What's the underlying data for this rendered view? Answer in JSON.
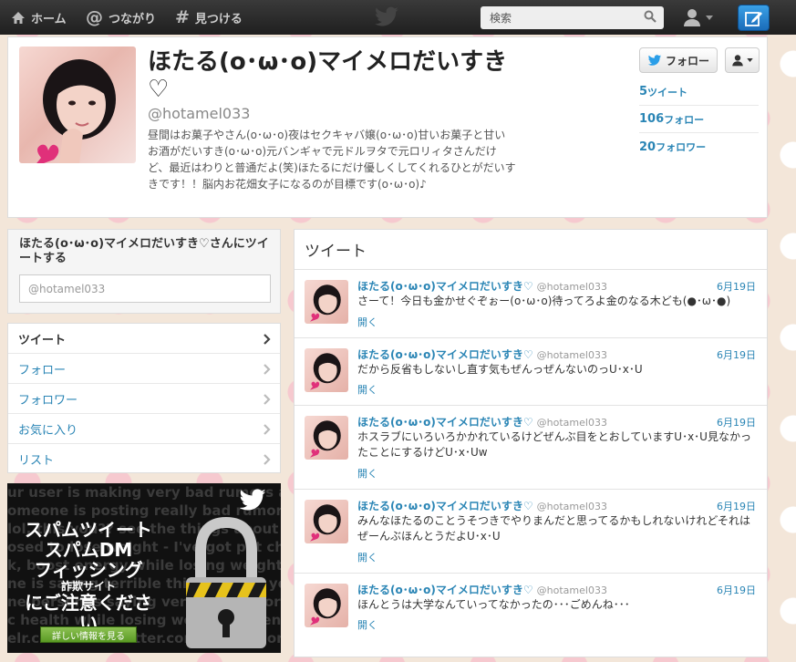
{
  "topbar": {
    "home_label": "ホーム",
    "connect_label": "つながり",
    "discover_label": "見つける",
    "search_placeholder": "検索"
  },
  "profile": {
    "name": "ほたる(o･ω･o)マイメロだいすき♡",
    "handle": "@hotamel033",
    "bio": "昼間はお菓子やさん(o･ω･o)夜はセクキャバ嬢(o･ω･o)甘いお菓子と甘いお酒がだいすき(o･ω･o)元バンギャで元ドルヲタで元ロリィタさんだけど、最近はわりと普通だよ(笑)ほたるにだけ優しくしてくれるひとがだいすきです！！脳内お花畑女子になるのが目標です(o･ω･o)♪",
    "follow_label": "フォロー",
    "stats": [
      {
        "num": "5",
        "label": "ツイート"
      },
      {
        "num": "106",
        "label": "フォロー"
      },
      {
        "num": "20",
        "label": "フォロワー"
      }
    ]
  },
  "tweetbox": {
    "title": "ほたる(o･ω･o)マイメロだいすき♡さんにツイートする",
    "value": "@hotamel033"
  },
  "leftnav": [
    {
      "label": "ツイート"
    },
    {
      "label": "フォロー"
    },
    {
      "label": "フォロワー"
    },
    {
      "label": "お気に入り"
    },
    {
      "label": "リスト"
    }
  ],
  "spam": {
    "bg_lines": [
      "ur user is making very bad rumors abou",
      "omeone is posting really bad rumors ab",
      "lol, this you?? see the things about you",
      "osed to lose weight - I've got pet changes",
      "k, boost energy while losing weight, health",
      "ne is saying terrible things about you...",
      "ne person is saying very bad rumors about",
      "c health while losing weight and energy",
      "elr.com  www.twitter.com  twitter.com"
    ],
    "line1": "スパムツイート",
    "line2": "スパムDM",
    "line3": "フィッシング",
    "line4": "詐欺サイト",
    "line5": "にご注意ください",
    "button": "詳しい情報を見る"
  },
  "timeline": {
    "header": "ツイート",
    "tweets": [
      {
        "name": "ほたる(o･ω･o)マイメロだいすき♡",
        "handle": "@hotamel033",
        "date": "6月19日",
        "text": "さーて！今日も金かせぐぞぉー(o･ω･o)待ってろよ金のなる木ども(●･ω･●)",
        "open": "開く"
      },
      {
        "name": "ほたる(o･ω･o)マイメロだいすき♡",
        "handle": "@hotamel033",
        "date": "6月19日",
        "text": "だから反省もしないし直す気もぜんっぜんないのっU･x･U",
        "open": "開く"
      },
      {
        "name": "ほたる(o･ω･o)マイメロだいすき♡",
        "handle": "@hotamel033",
        "date": "6月19日",
        "text": "ホスラブにいろいろかかれているけどぜんぶ目をとおしていますU･x･U見なかったことにするけどU･x･Uw",
        "open": "開く"
      },
      {
        "name": "ほたる(o･ω･o)マイメロだいすき♡",
        "handle": "@hotamel033",
        "date": "6月19日",
        "text": "みんなほたるのことうそつきでやりまんだと思ってるかもしれないけれどそれはぜーんぶほんとうだよU･x･U",
        "open": "開く"
      },
      {
        "name": "ほたる(o･ω･o)マイメロだいすき♡",
        "handle": "@hotamel033",
        "date": "6月19日",
        "text": "ほんとうは大学なんていってなかったの･･･ごめんね･･･",
        "open": "開く"
      }
    ]
  }
}
